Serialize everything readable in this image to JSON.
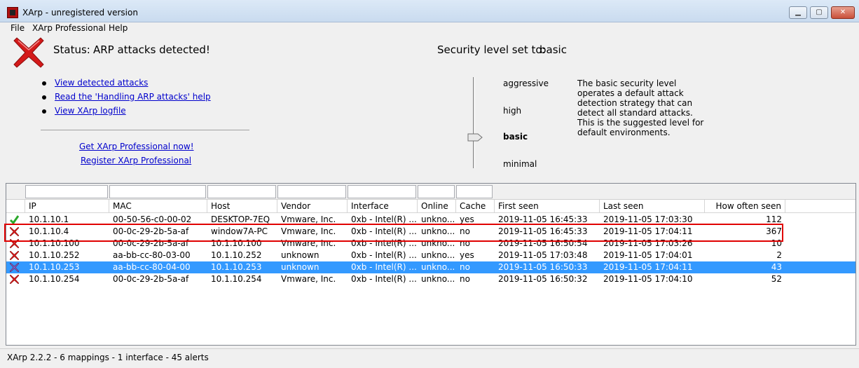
{
  "window": {
    "title": "XArp - unregistered version"
  },
  "menu": [
    "File",
    "XArp Professional",
    "Help"
  ],
  "status": {
    "label": "Status:",
    "value": "ARP attacks detected!"
  },
  "links": [
    "View detected attacks",
    "Read the 'Handling ARP attacks' help",
    "View XArp logfile"
  ],
  "promo": {
    "get_pro": "Get XArp Professional now!",
    "register": "Register XArp Professional"
  },
  "security": {
    "label": "Security level set to:",
    "value": "basic",
    "levels": [
      "aggressive",
      "high",
      "basic",
      "minimal"
    ],
    "selected_level": "basic",
    "description": "The basic security level operates a default attack detection strategy that can detect all standard attacks. This is the suggested level for default environments."
  },
  "table": {
    "columns": [
      "IP",
      "MAC",
      "Host",
      "Vendor",
      "Interface",
      "Online",
      "Cache",
      "First seen",
      "Last seen",
      "How often seen"
    ],
    "rows": [
      {
        "status": "ok",
        "ip": "10.1.10.1",
        "mac": "00-50-56-c0-00-02",
        "host": "DESKTOP-7EQ",
        "vendor": "Vmware, Inc.",
        "interface": "0xb - Intel(R) ...",
        "online": "unkno...",
        "cache": "yes",
        "first_seen": "2019-11-05 16:45:33",
        "last_seen": "2019-11-05 17:03:30",
        "count": "112"
      },
      {
        "status": "alert",
        "ip": "10.1.10.4",
        "mac": "00-0c-29-2b-5a-af",
        "host": "window7A-PC",
        "vendor": "Vmware, Inc.",
        "interface": "0xb - Intel(R) ...",
        "online": "unkno...",
        "cache": "no",
        "first_seen": "2019-11-05 16:45:33",
        "last_seen": "2019-11-05 17:04:11",
        "count": "367"
      },
      {
        "status": "alert",
        "ip": "10.1.10.100",
        "mac": "00-0c-29-2b-5a-af",
        "host": "10.1.10.100",
        "vendor": "Vmware, Inc.",
        "interface": "0xb - Intel(R) ...",
        "online": "unkno...",
        "cache": "no",
        "first_seen": "2019-11-05 16:50:54",
        "last_seen": "2019-11-05 17:03:26",
        "count": "10"
      },
      {
        "status": "alert",
        "ip": "10.1.10.252",
        "mac": "aa-bb-cc-80-03-00",
        "host": "10.1.10.252",
        "vendor": "unknown",
        "interface": "0xb - Intel(R) ...",
        "online": "unkno...",
        "cache": "yes",
        "first_seen": "2019-11-05 17:03:48",
        "last_seen": "2019-11-05 17:04:01",
        "count": "2"
      },
      {
        "status": "alert",
        "ip": "10.1.10.253",
        "mac": "aa-bb-cc-80-04-00",
        "host": "10.1.10.253",
        "vendor": "unknown",
        "interface": "0xb - Intel(R) ...",
        "online": "unkno...",
        "cache": "no",
        "first_seen": "2019-11-05 16:50:33",
        "last_seen": "2019-11-05 17:04:11",
        "count": "43"
      },
      {
        "status": "alert",
        "ip": "10.1.10.254",
        "mac": "00-0c-29-2b-5a-af",
        "host": "10.1.10.254",
        "vendor": "Vmware, Inc.",
        "interface": "0xb - Intel(R) ...",
        "online": "unkno...",
        "cache": "no",
        "first_seen": "2019-11-05 16:50:32",
        "last_seen": "2019-11-05 17:04:10",
        "count": "52"
      }
    ],
    "selected_row": 4,
    "highlighted_row": 1
  },
  "statusbar": {
    "text": "XArp 2.2.2  -  6 mappings  -  1 interface  -  45 alerts"
  },
  "colors": {
    "selection": "#3399ff",
    "link": "#0000cc",
    "alert_red": "#d41a1a",
    "ok_green": "#2aa82a",
    "highlight_box": "#e00000"
  }
}
